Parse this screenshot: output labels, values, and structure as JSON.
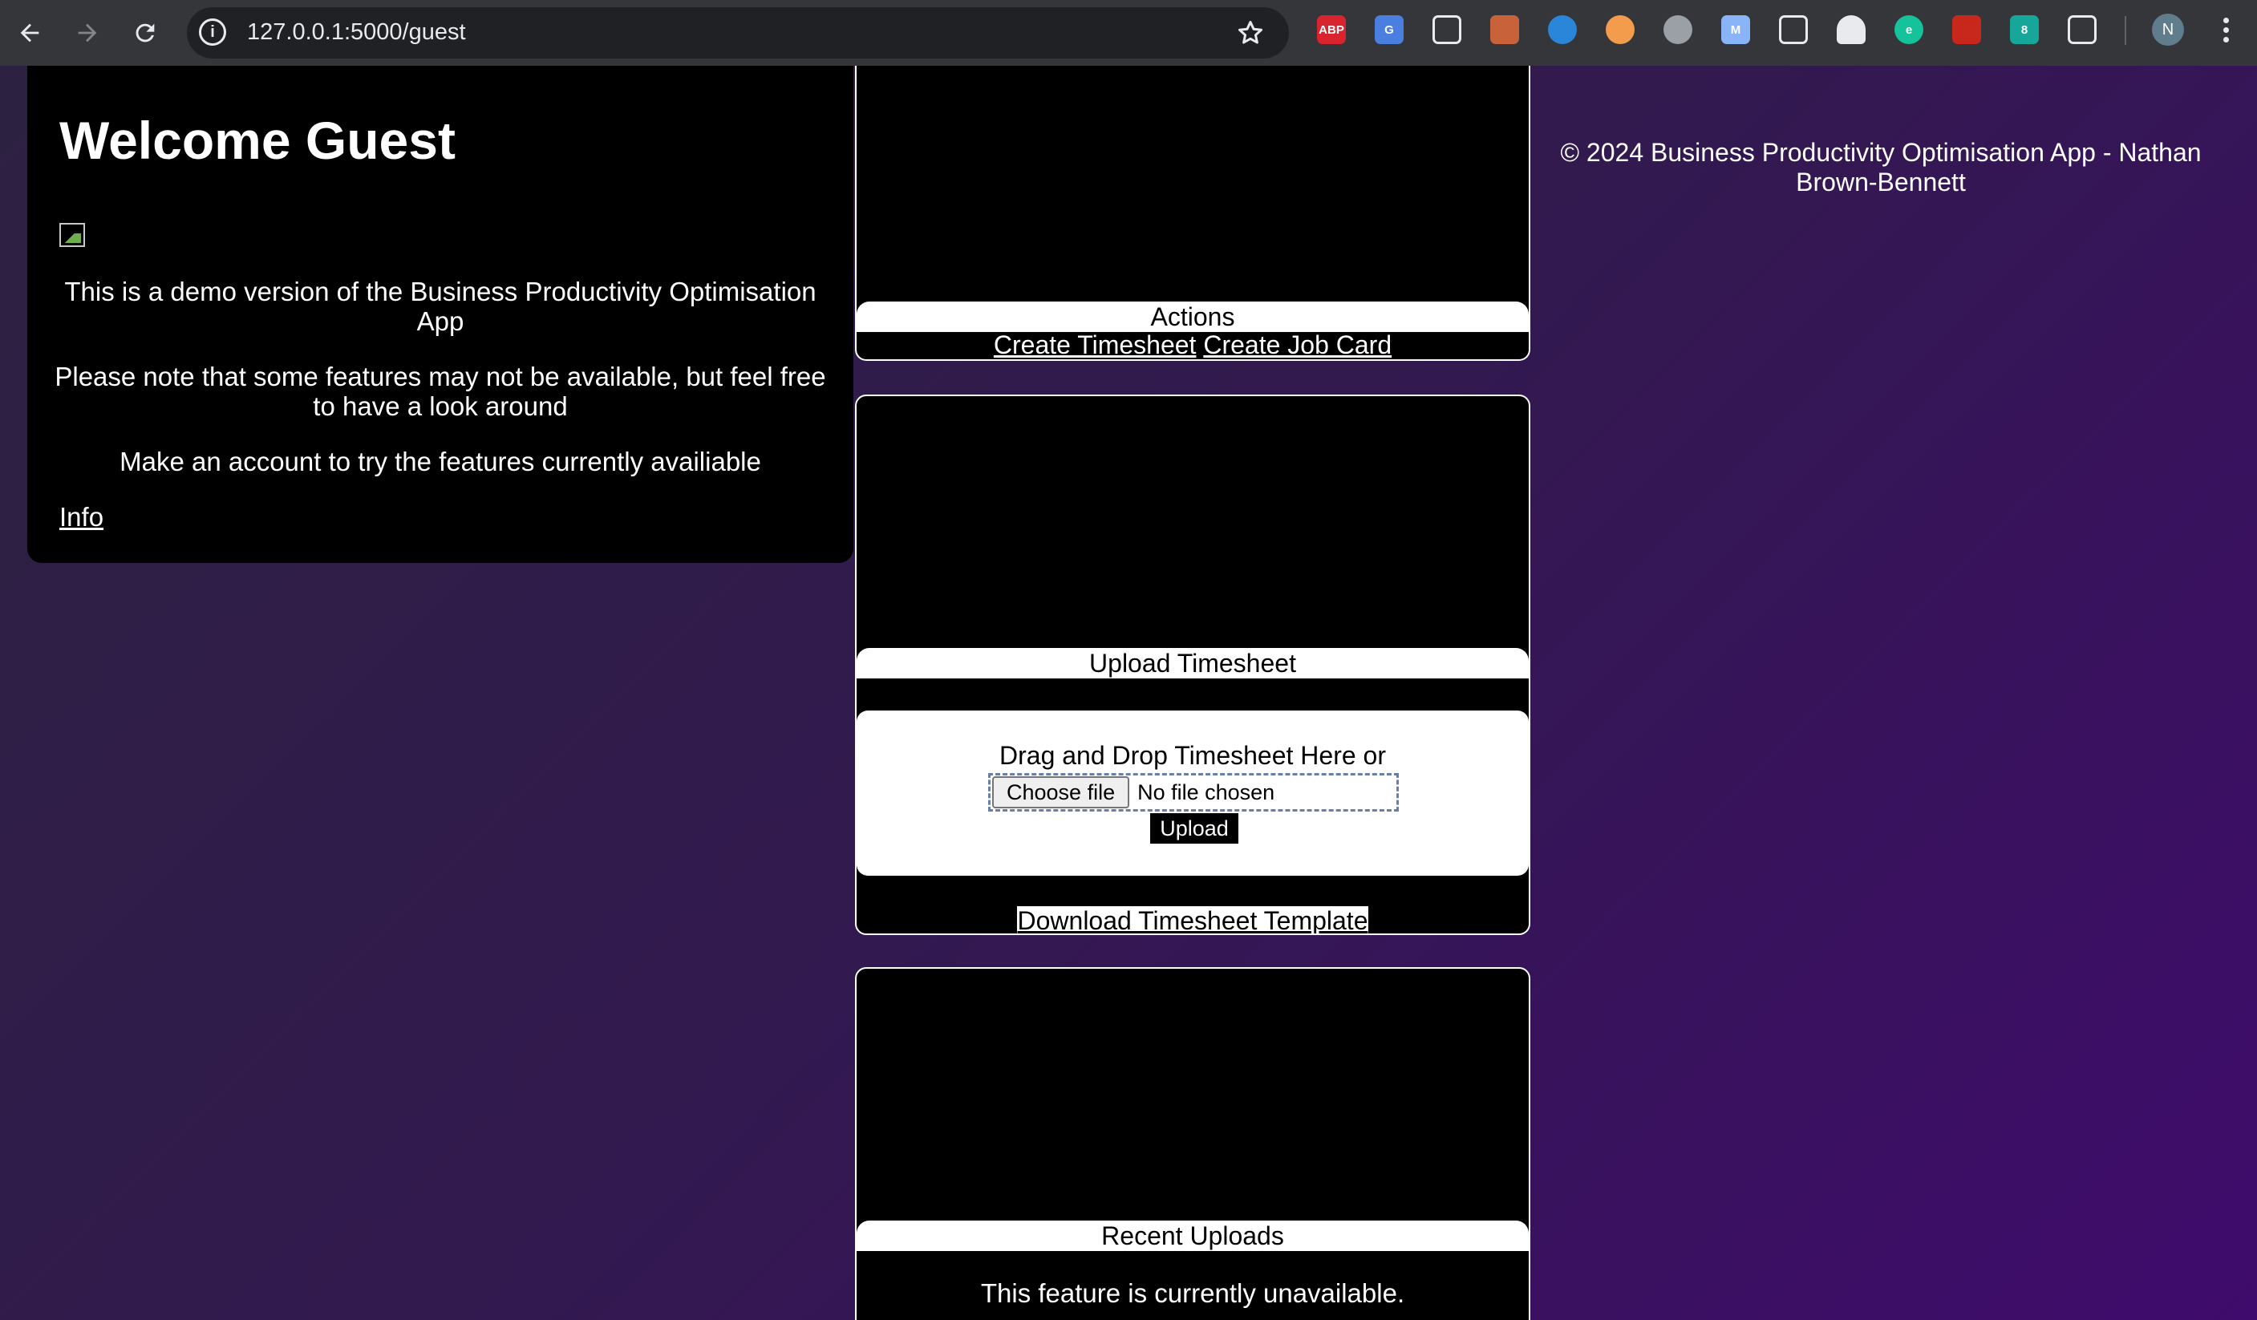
{
  "browser": {
    "url": "127.0.0.1:5000/guest",
    "profile_initial": "N",
    "extensions": [
      {
        "name": "adblock-plus-icon",
        "label": "ABP",
        "color": "#d9232e"
      },
      {
        "name": "google-translate-icon",
        "label": "G",
        "color": "#4a7ee0"
      },
      {
        "name": "screen-capture-icon",
        "label": "",
        "color": "#e8eaed"
      },
      {
        "name": "gallery-icon",
        "label": "",
        "color": "#c7623a"
      },
      {
        "name": "edge-icon",
        "label": "",
        "color": "#2a86d8"
      },
      {
        "name": "capsule-icon",
        "label": "",
        "color": "#f39c4b"
      },
      {
        "name": "target-icon",
        "label": "",
        "color": "#9aa0a6"
      },
      {
        "name": "mail-icon",
        "label": "M",
        "color": "#8ab4f8"
      },
      {
        "name": "pip-icon",
        "label": "",
        "color": "#e8eaed"
      },
      {
        "name": "bell-icon",
        "label": "",
        "color": "#202124"
      },
      {
        "name": "grammarly-icon",
        "label": "e",
        "color": "#15c39a"
      },
      {
        "name": "pdf-icon",
        "label": "",
        "color": "#c8271b"
      },
      {
        "name": "eight-icon",
        "label": "8",
        "color": "#16a69a"
      },
      {
        "name": "puzzle-icon",
        "label": "",
        "color": "#e8eaed"
      }
    ]
  },
  "welcome": {
    "title": "Welcome Guest",
    "para1": "This is a demo version of the Business Productivity Optimisation App",
    "para2": "Please note that some features may not be available, but feel free to have a look around",
    "para3": "Make an account to try the features currently availiable",
    "info_link": "Info"
  },
  "actions": {
    "title": "Actions",
    "create_timesheet": "Create Timesheet",
    "create_job_card": "Create Job Card"
  },
  "upload": {
    "title": "Upload Timesheet",
    "drop_text": "Drag and Drop Timesheet Here or",
    "choose_file": "Choose file",
    "no_file": "No file chosen",
    "upload_button": "Upload",
    "template_link": "Download Timesheet Template"
  },
  "recent": {
    "title": "Recent Uploads",
    "unavailable": "This feature is currently unavailable."
  },
  "footer": {
    "text": "© 2024 Business Productivity Optimisation App - Nathan Brown-Bennett"
  }
}
